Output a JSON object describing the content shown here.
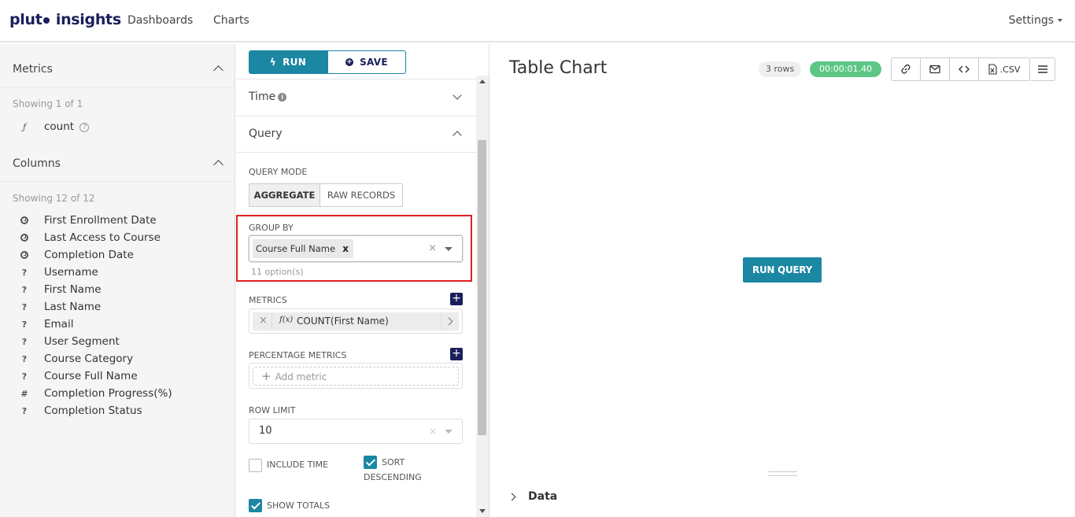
{
  "nav": {
    "logo_left": "plut",
    "logo_right": "insights",
    "links": [
      "Dashboards",
      "Charts"
    ],
    "settings": "Settings"
  },
  "left": {
    "metrics_title": "Metrics",
    "metrics_showing": "Showing 1 of 1",
    "metric_icon": "ƒ",
    "metric_name": "count",
    "columns_title": "Columns",
    "columns_showing": "Showing 12 of 12",
    "columns": [
      {
        "icon": "clock",
        "label": "First Enrollment Date"
      },
      {
        "icon": "clock",
        "label": "Last Access to Course"
      },
      {
        "icon": "clock",
        "label": "Completion Date"
      },
      {
        "icon": "?",
        "label": "Username"
      },
      {
        "icon": "?",
        "label": "First Name"
      },
      {
        "icon": "?",
        "label": "Last Name"
      },
      {
        "icon": "?",
        "label": "Email"
      },
      {
        "icon": "?",
        "label": "User Segment"
      },
      {
        "icon": "?",
        "label": "Course Category"
      },
      {
        "icon": "?",
        "label": "Course Full Name"
      },
      {
        "icon": "#",
        "label": "Completion Progress(%)"
      },
      {
        "icon": "?",
        "label": "Completion Status"
      }
    ]
  },
  "mid": {
    "run_label": "RUN",
    "save_label": "SAVE",
    "time_section": "Time",
    "query_section": "Query",
    "query_mode_label": "QUERY MODE",
    "mode_aggregate": "AGGREGATE",
    "mode_raw": "RAW RECORDS",
    "group_by_label": "GROUP BY",
    "group_by_tag": "Course Full Name",
    "group_by_options": "11 option(s)",
    "metrics_label": "METRICS",
    "metric_fx": "f(x)",
    "metric_value": "COUNT(First Name)",
    "pct_metrics_label": "PERCENTAGE METRICS",
    "add_metric_placeholder": "Add metric",
    "row_limit_label": "ROW LIMIT",
    "row_limit_value": "10",
    "include_time": "INCLUDE TIME",
    "sort_descending_1": "SORT",
    "sort_descending_2": "DESCENDING",
    "show_totals": "SHOW TOTALS"
  },
  "right": {
    "title": "Table Chart",
    "rows_badge": "3 rows",
    "time_badge": "00:00:01.40",
    "csv_label": ".CSV",
    "run_query": "RUN QUERY",
    "data_toggle": "Data"
  },
  "colors": {
    "accent": "#1b87a3",
    "brand": "#1a1f5c",
    "success": "#5cc685",
    "highlight": "#e02020"
  }
}
